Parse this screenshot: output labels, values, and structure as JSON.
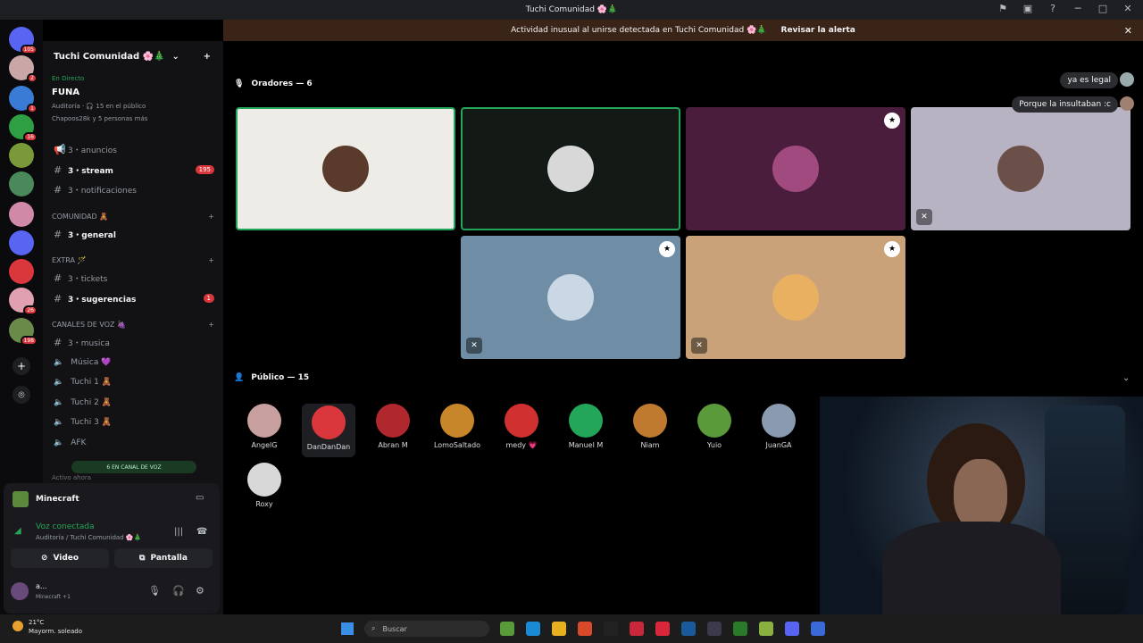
{
  "window": {
    "title": "Tuchi Comunidad 🌸🎄"
  },
  "alert": {
    "text": "Actividad inusual al unirse detectada en Tuchi Comunidad 🌸🎄",
    "action": "Revisar la alerta"
  },
  "servers": [
    {
      "color": "#5865f2",
      "badge": "105"
    },
    {
      "color": "#c9a7a7",
      "badge": "2"
    },
    {
      "color": "#3a7bd5",
      "badge": "1"
    },
    {
      "color": "#2ea043",
      "badge": "16"
    },
    {
      "color": "#7a9a3a",
      "badge": ""
    },
    {
      "color": "#4a8a5a",
      "badge": ""
    },
    {
      "color": "#d08aa8",
      "badge": ""
    },
    {
      "color": "#5865f2",
      "badge": ""
    },
    {
      "color": "#da373c",
      "badge": ""
    },
    {
      "color": "#e0a0b0",
      "badge": "26"
    },
    {
      "color": "#6a8a4a",
      "badge": "198"
    }
  ],
  "guild": {
    "name": "Tuchi Comunidad 🌸🎄"
  },
  "stage": {
    "live": "En Directo",
    "name": "FUNA",
    "meta": "Auditoría · 🎧 15 en el público",
    "meta2": "Chapoos28k y 5 personas más"
  },
  "channels": [
    {
      "name": "3・anuncios",
      "bold": false,
      "badge": ""
    },
    {
      "name": "3・stream",
      "bold": true,
      "badge": "195"
    },
    {
      "name": "3・notificaciones",
      "bold": false,
      "badge": ""
    }
  ],
  "cat_comunidad": "COMUNIDAD 🧸",
  "ch_general": "3・general",
  "cat_extra": "EXTRA 🪄",
  "ch_tickets": "3・tickets",
  "ch_sugerencias": {
    "name": "3・sugerencias",
    "badge": "1"
  },
  "cat_voz": "CANALES DE VOZ 🍇",
  "ch_musica_text": "3・musica",
  "voice_channels": [
    "Música 💜",
    "Tuchi 1 🧸",
    "Tuchi 2 🧸",
    "Tuchi 3 🧸",
    "AFK"
  ],
  "in_voice": "6 EN CANAL DE VOZ",
  "activo": "Activo ahora",
  "activity": {
    "game": "Minecraft"
  },
  "voice": {
    "status": "Voz conectada",
    "where": "Auditoría / Tuchi Comunidad 🌸🎄"
  },
  "buttons": {
    "video": "Video",
    "screen": "Pantalla"
  },
  "user": {
    "name": "a...",
    "sub": "Minecraft +1"
  },
  "speakers": {
    "header": "Oradores — 6"
  },
  "audience": {
    "header": "Público — 15",
    "members": [
      {
        "name": "AngelG",
        "color": "#c9a0a0"
      },
      {
        "name": "DanDanDan",
        "color": "#da373c"
      },
      {
        "name": "Abran M",
        "color": "#b0282e"
      },
      {
        "name": "LomoSaltado",
        "color": "#c8862a"
      },
      {
        "name": "medy 💗",
        "color": "#d03030"
      },
      {
        "name": "Manuel M",
        "color": "#23a55a"
      },
      {
        "name": "Niam",
        "color": "#c07a30"
      },
      {
        "name": "Yuio",
        "color": "#5a9a3a"
      },
      {
        "name": "JuanGA",
        "color": "#8a9ab0"
      },
      {
        "name": "Roxy",
        "color": "#d8d8d8"
      }
    ]
  },
  "chat": [
    "ya es legal",
    "Porque la insultaban :c"
  ],
  "taskbar": {
    "weather_temp": "21°C",
    "weather_text": "Mayorm. soleado",
    "search": "Buscar"
  }
}
